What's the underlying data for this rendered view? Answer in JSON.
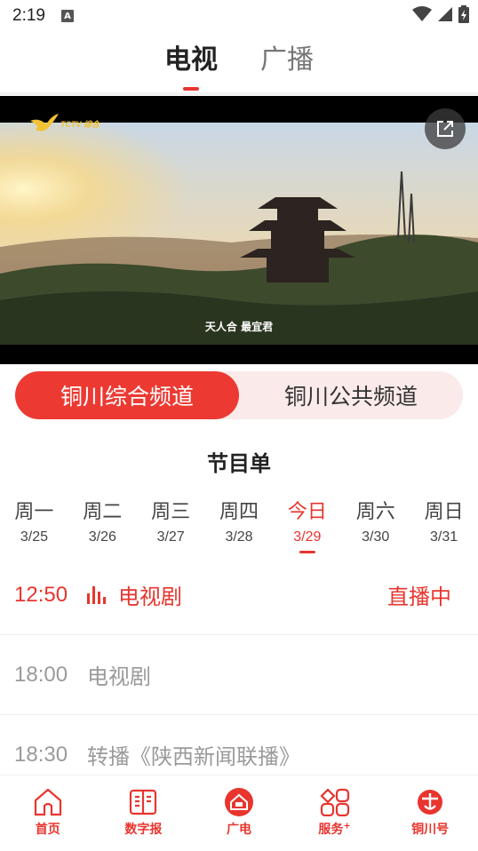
{
  "status_bar": {
    "time": "2:19",
    "notification_icon": "A"
  },
  "top_tabs": [
    {
      "label": "电视",
      "active": true
    },
    {
      "label": "广播",
      "active": false
    }
  ],
  "video": {
    "channel_logo_text": "TCTV 综合",
    "caption": "天人合 最宜君"
  },
  "channels": [
    {
      "label": "铜川综合频道",
      "active": true
    },
    {
      "label": "铜川公共频道",
      "active": false
    }
  ],
  "schedule": {
    "title": "节目单",
    "days": [
      {
        "weekday": "周一",
        "date": "3/25",
        "active": false
      },
      {
        "weekday": "周二",
        "date": "3/26",
        "active": false
      },
      {
        "weekday": "周三",
        "date": "3/27",
        "active": false
      },
      {
        "weekday": "周四",
        "date": "3/28",
        "active": false
      },
      {
        "weekday": "今日",
        "date": "3/29",
        "active": true
      },
      {
        "weekday": "周六",
        "date": "3/30",
        "active": false
      },
      {
        "weekday": "周日",
        "date": "3/31",
        "active": false
      }
    ],
    "programs": [
      {
        "time": "12:50",
        "name": "电视剧",
        "status": "直播中",
        "live": true
      },
      {
        "time": "18:00",
        "name": "电视剧",
        "status": "",
        "live": false
      },
      {
        "time": "18:30",
        "name": "转播《陕西新闻联播》",
        "status": "",
        "live": false
      }
    ]
  },
  "bottom_nav": [
    {
      "label": "首页",
      "icon": "home-icon"
    },
    {
      "label": "数字报",
      "icon": "newspaper-icon"
    },
    {
      "label": "广电",
      "icon": "broadcast-home-icon"
    },
    {
      "label": "服务",
      "superscript": "+",
      "icon": "grid-icon"
    },
    {
      "label": "铜川号",
      "icon": "tongchuan-logo-icon"
    }
  ],
  "colors": {
    "accent": "#e8352e",
    "channel_bg": "#fbeaea"
  }
}
